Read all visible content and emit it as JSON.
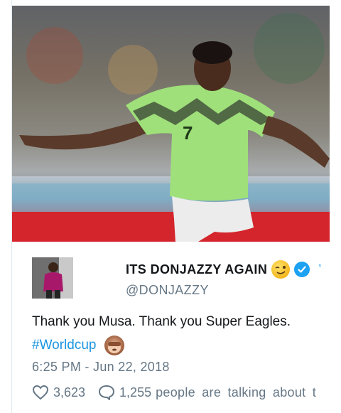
{
  "tweet": {
    "author_name": "ITS DONJAZZY  AGAIN",
    "handle": "@DONJAZZY",
    "text": "Thank you Musa. Thank you Super Eagles.",
    "hashtag": "#Worldcup",
    "timestamp": "6:25  PM  -  Jun  22,  2018",
    "likes": "3,623",
    "replies": "1,255",
    "talking_text": "people are talking about t",
    "header_truncation": "’"
  },
  "media": {
    "jersey_number": "7"
  },
  "icons": {
    "author_emoji": "winking-face-icon",
    "verified": "verified-badge-icon",
    "hashtag_emoji": "see-no-evil-monkey-icon",
    "like": "heart-icon",
    "reply": "speech-bubble-icon"
  },
  "colors": {
    "link": "#1b95e0",
    "verified": "#1da1f2",
    "muted": "#657786",
    "text": "#14171a"
  }
}
